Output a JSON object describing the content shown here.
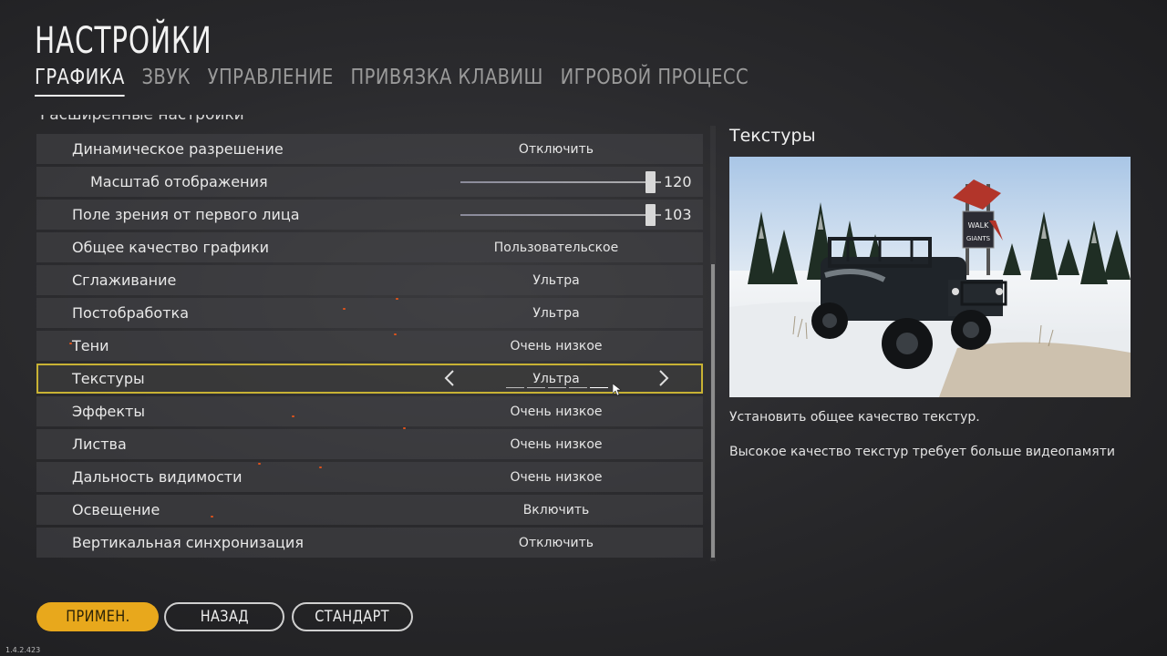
{
  "header": {
    "title": "НАСТРОЙКИ",
    "tabs": [
      {
        "label": "ГРАФИКА",
        "active": true
      },
      {
        "label": "ЗВУК",
        "active": false
      },
      {
        "label": "УПРАВЛЕНИЕ",
        "active": false
      },
      {
        "label": "ПРИВЯЗКА КЛАВИШ",
        "active": false
      },
      {
        "label": "ИГРОВОЙ ПРОЦЕСС",
        "active": false
      }
    ]
  },
  "section_label": "Расширенные настройки",
  "settings": [
    {
      "label": "Динамическое разрешение",
      "value": "Отключить"
    },
    {
      "label": "Масштаб отображения",
      "value": "120",
      "type": "slider"
    },
    {
      "label": "Поле зрения от первого лица",
      "value": "103",
      "type": "slider"
    },
    {
      "label": "Общее качество графики",
      "value": "Пользовательское"
    },
    {
      "label": "Сглаживание",
      "value": "Ультра"
    },
    {
      "label": "Постобработка",
      "value": "Ультра"
    },
    {
      "label": "Тени",
      "value": "Очень низкое"
    },
    {
      "label": "Текстуры",
      "value": "Ультра",
      "selected": true
    },
    {
      "label": "Эффекты",
      "value": "Очень низкое"
    },
    {
      "label": "Листва",
      "value": "Очень низкое"
    },
    {
      "label": "Дальность видимости",
      "value": "Очень низкое"
    },
    {
      "label": "Освещение",
      "value": "Включить"
    },
    {
      "label": "Вертикальная синхронизация",
      "value": "Отключить"
    }
  ],
  "slider_levels": {
    "display_scale": 0.97,
    "fov": 0.97
  },
  "detail": {
    "title": "Текстуры",
    "desc_line1": "Установить общее качество текстур.",
    "desc_line2": "Высокое качество текстур требует больше видеопамяти"
  },
  "buttons": {
    "apply": "ПРИМЕН.",
    "back": "НАЗАД",
    "default": "СТАНДАРТ"
  },
  "version": "1.4.2.423",
  "colors": {
    "accent": "#e8a81c",
    "selection_outline": "#c8b234",
    "row_bg": "#464649"
  },
  "icons": {
    "prev": "chevron-left-icon",
    "next": "chevron-right-icon"
  }
}
